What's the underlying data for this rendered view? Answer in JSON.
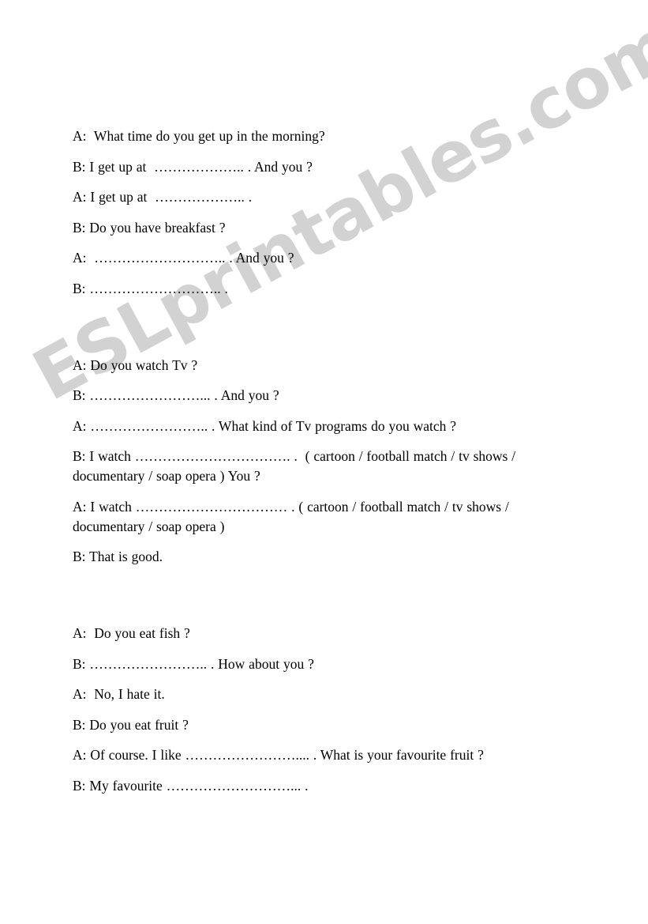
{
  "document": {
    "type": "worksheet",
    "background_color": "#ffffff",
    "text_color": "#000000"
  },
  "watermark": {
    "text": "ESLprintables.com",
    "color": "#d2d2d2",
    "rotation_deg": -28.5
  },
  "sections": [
    {
      "name": "morning-routine-dialogue",
      "lines": [
        "A:  What time do you get up in the morning?",
        "B: I get up at  ……………….. . And you ?",
        "A: I get up at  ……………….. .",
        "B: Do you have breakfast ?",
        "A:  ……………………….. . And you ?",
        "B: ……………………….. ."
      ]
    },
    {
      "name": "tv-dialogue",
      "lines": [
        "A: Do you watch Tv ?",
        "B: ……………………... . And you ?",
        "A: …………………….. . What kind of Tv programs do you watch ?",
        "B: I watch ……………………………. .  ( cartoon / football match / tv shows / documentary / soap opera ) You ?",
        "A: I watch …………………………… . ( cartoon / football match / tv shows / documentary / soap opera )",
        "B: That is good."
      ]
    },
    {
      "name": "food-dialogue",
      "lines": [
        "A:  Do you eat fish ?",
        "B: …………………….. . How about you ?",
        "A:  No, I hate it.",
        "B: Do you eat fruit ?",
        "A: Of course. I like …………………….... . What is your favourite fruit ?",
        "B: My favourite ………………………... ."
      ]
    }
  ]
}
